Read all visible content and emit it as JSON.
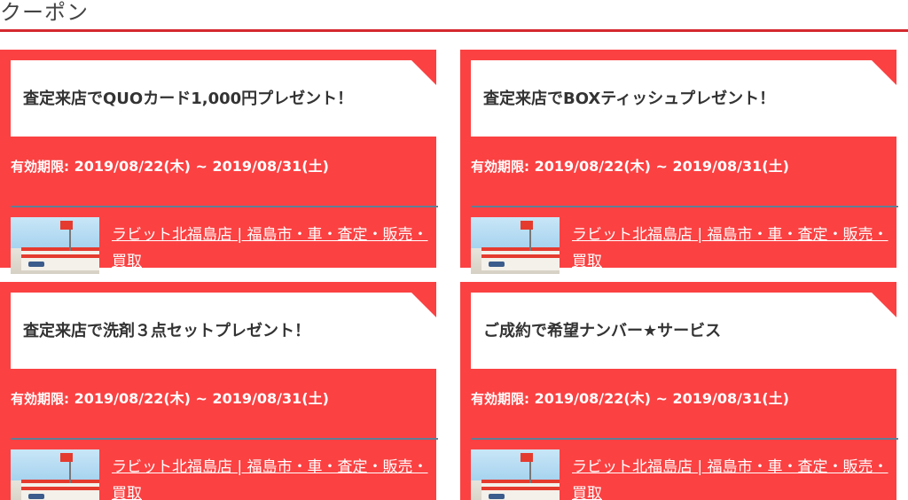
{
  "section": {
    "title": "クーポン"
  },
  "coupons": [
    {
      "title": "査定来店でQUOカード1,000円プレゼント！",
      "validity_label": "有効期限:",
      "validity_range": "2019/08/22(木) ~ 2019/08/31(土)",
      "shop_link": "ラビット北福島店 | 福島市・車・査定・販売・買取"
    },
    {
      "title": "査定来店でBOXティッシュプレゼント！",
      "validity_label": "有効期限:",
      "validity_range": "2019/08/22(木) ~ 2019/08/31(土)",
      "shop_link": "ラビット北福島店 | 福島市・車・査定・販売・買取"
    },
    {
      "title": "査定来店で洗剤３点セットプレゼント！",
      "validity_label": "有効期限:",
      "validity_range": "2019/08/22(木) ~ 2019/08/31(土)",
      "shop_link": "ラビット北福島店 | 福島市・車・査定・販売・買取"
    },
    {
      "title": "ご成約で希望ナンバー★サービス",
      "validity_label": "有効期限:",
      "validity_range": "2019/08/22(木) ~ 2019/08/31(土)",
      "shop_link": "ラビット北福島店 | 福島市・車・査定・販売・買取"
    }
  ],
  "colors": {
    "card_background": "#fb4142",
    "header_rule": "#d4282e",
    "divider": "#5f7f96",
    "title_text": "#333333"
  }
}
